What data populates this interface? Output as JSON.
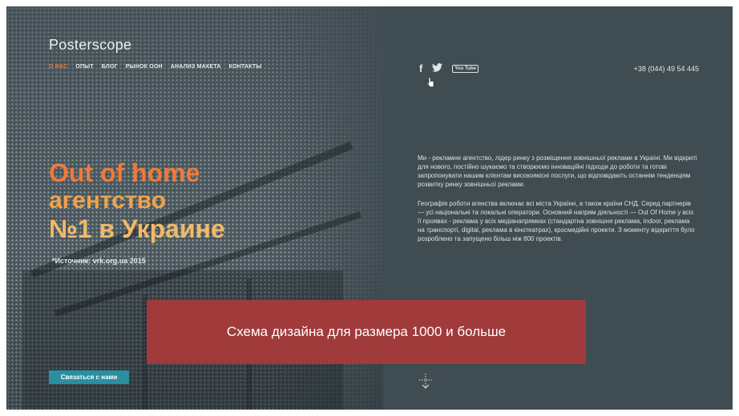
{
  "header": {
    "logo": "Posterscope",
    "nav": [
      {
        "label": "О НАС",
        "active": true
      },
      {
        "label": "ОПЫТ"
      },
      {
        "label": "БЛОГ"
      },
      {
        "label": "РЫНОК ООН"
      },
      {
        "label": "АНАЛИЗ МАКЕТА"
      },
      {
        "label": "КОНТАКТЫ"
      }
    ],
    "social": {
      "facebook": "f",
      "twitter_icon": "twitter-icon",
      "youtube": "You Tube"
    },
    "phone": "+38 (044) 49 54 445"
  },
  "hero": {
    "line1": "Out of home",
    "line2": "агентство",
    "line3": "№1 в Украине",
    "source": "*Источник: vrk.org.ua 2015"
  },
  "about": {
    "p1": "Ми - рекламне агентство, лідер ринку з розміщення зовнішньої реклами в Україні. Ми відкриті для нового, постійно шукаємо та створюємо інноваційні підходи до роботи та готові запропонувати нашим клієнтам високоякісні послуги, що відповідають останнім тенденціям розвитку ринку зовнішньої реклами.",
    "p2": "Географія роботи агенства включає всі міста України, а також країни СНД. Серед партнерів — усі національні та локальні оператори. Основний напрям діяльності — Out Of Home у всіх її проявах - реклама у всіх медіанапрямках (стандартна зовнішня реклама, indoor, реклама на транспорті, digital, реклама в кінотеатрах), кросмедійні проекти. З моменту відкриття було розроблено та запущено більш ніж 800 проектів."
  },
  "banner": {
    "text": "Схема дизайна для размера 1000 и больше"
  },
  "cta": {
    "label": "Связаться с нами"
  },
  "colors": {
    "accent_orange": "#ef7a3a",
    "background": "#3f4c52",
    "banner_red": "#a13a3a",
    "button_teal": "#2a8fa0"
  }
}
